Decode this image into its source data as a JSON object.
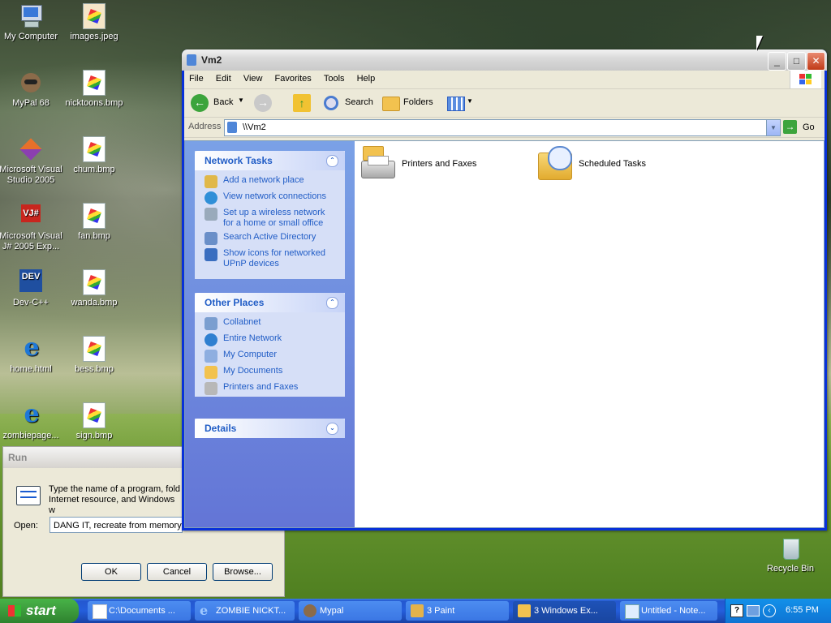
{
  "desktop": {
    "icons": [
      {
        "label": "My Computer"
      },
      {
        "label": "images.jpeg"
      },
      {
        "label": "MyPal 68"
      },
      {
        "label": "nicktoons.bmp"
      },
      {
        "label": "Microsoft Visual Studio 2005"
      },
      {
        "label": "chum.bmp"
      },
      {
        "label": "Microsoft Visual J# 2005 Exp..."
      },
      {
        "label": "fan.bmp"
      },
      {
        "label": "Dev-C++"
      },
      {
        "label": "wanda.bmp"
      },
      {
        "label": "home.html"
      },
      {
        "label": "bess.bmp"
      },
      {
        "label": "zombiepage..."
      },
      {
        "label": "sign.bmp"
      },
      {
        "label": "Recycle Bin"
      }
    ]
  },
  "window": {
    "title": "Vm2",
    "menu": [
      "File",
      "Edit",
      "View",
      "Favorites",
      "Tools",
      "Help"
    ],
    "toolbar": {
      "back": "Back",
      "search": "Search",
      "folders": "Folders"
    },
    "address": {
      "label": "Address",
      "value": "\\\\Vm2",
      "go": "Go"
    },
    "network_tasks": {
      "title": "Network Tasks",
      "items": [
        {
          "label": "Add a network place"
        },
        {
          "label": "View network connections"
        },
        {
          "label": "Set up a wireless network for a home or small office"
        },
        {
          "label": "Search Active Directory"
        },
        {
          "label": "Show icons for networked UPnP devices"
        }
      ]
    },
    "other_places": {
      "title": "Other Places",
      "items": [
        {
          "label": "Collabnet"
        },
        {
          "label": "Entire Network"
        },
        {
          "label": "My Computer"
        },
        {
          "label": "My Documents"
        },
        {
          "label": "Printers and Faxes"
        }
      ]
    },
    "details": {
      "title": "Details"
    },
    "items": [
      {
        "label": "Printers and Faxes"
      },
      {
        "label": "Scheduled Tasks"
      }
    ]
  },
  "run_dialog": {
    "title": "Run",
    "description": "Type the name of a program, fold Internet resource, and Windows w",
    "open_label": "Open:",
    "open_value": "DANG IT, recreate from memory",
    "ok": "OK",
    "cancel": "Cancel",
    "browse": "Browse..."
  },
  "taskbar": {
    "start": "start",
    "tasks": [
      {
        "label": "C:\\Documents ..."
      },
      {
        "label": "ZOMBIE NICKT..."
      },
      {
        "label": "Mypal"
      },
      {
        "label": "3 Paint"
      },
      {
        "label": "3 Windows Ex..."
      },
      {
        "label": "Untitled - Note..."
      }
    ],
    "clock": "6:55 PM"
  },
  "colors": {
    "xp_blue": "#0831d9",
    "task_blue": "#215dc6",
    "start_green": "#3c9b3c"
  }
}
